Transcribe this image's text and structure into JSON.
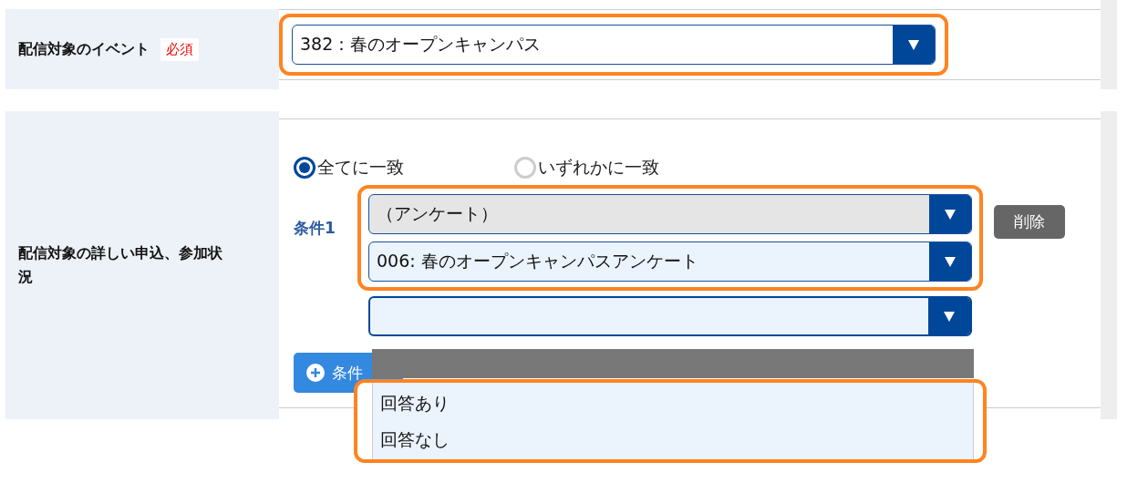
{
  "rows": [
    {
      "label": "配信対象のイベント",
      "required_badge": "必須",
      "select": {
        "value": "382：春のオープンキャンパス",
        "highlighted": true
      }
    },
    {
      "label": "配信対象の詳しい申込、参加状況",
      "match_options": [
        {
          "label": "全てに一致",
          "selected": true
        },
        {
          "label": "いずれかに一致",
          "selected": false
        }
      ],
      "conditions": [
        {
          "label": "条件1",
          "delete_button": "削除",
          "highlighted": true,
          "selects": [
            {
              "value": "（アンケート）",
              "disabled": true
            },
            {
              "value": "006: 春のオープンキャンパスアンケート",
              "disabled": false
            }
          ],
          "next_select": {
            "open": true
          }
        }
      ],
      "add_button": "条件",
      "dropdown_options": [
        {
          "label": "回答あり"
        },
        {
          "label": "回答なし"
        }
      ]
    }
  ]
}
